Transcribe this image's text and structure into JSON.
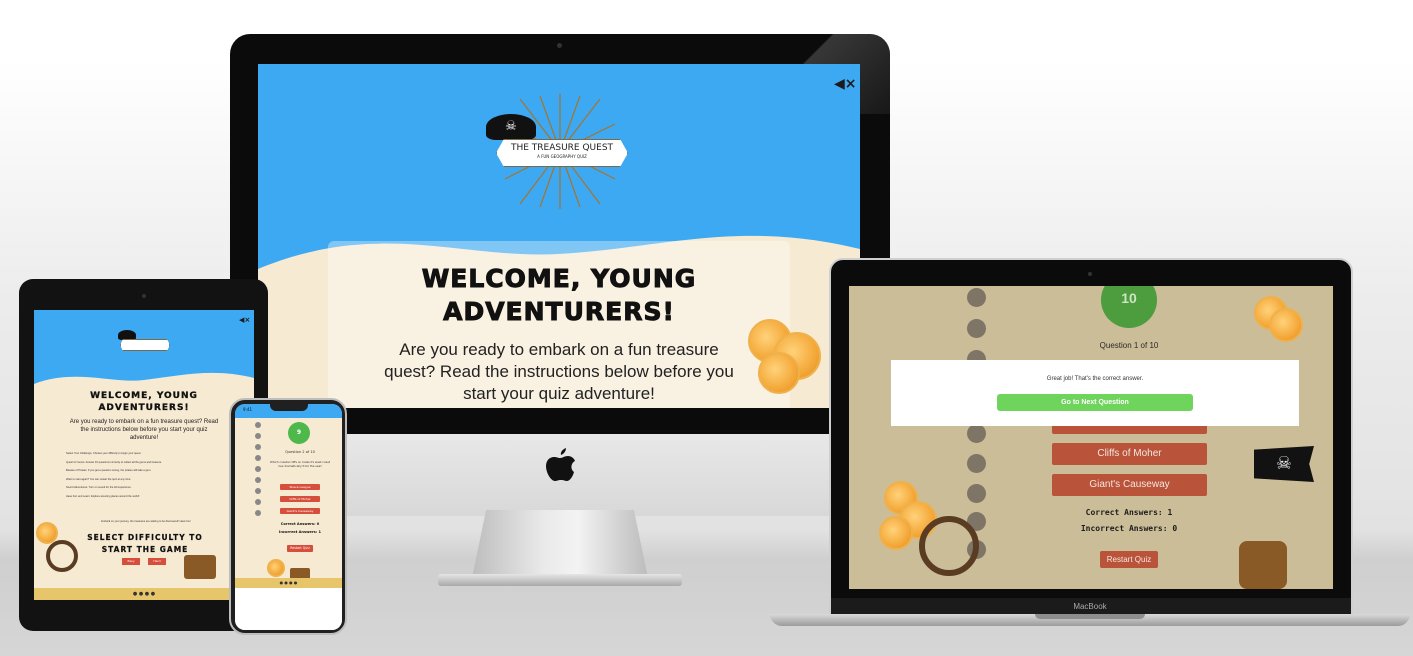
{
  "imac": {
    "logo_title": "THE TREASURE QUEST",
    "logo_subtitle": "A FUN GEOGRAPHY QUIZ",
    "mute_icon": "speaker-mute-icon",
    "heading": "WELCOME, YOUNG ADVENTURERS!",
    "intro": "Are you ready to embark on a fun treasure quest? Read the instructions below before you start your quiz adventure!"
  },
  "laptop": {
    "timer": "10",
    "question_counter": "Question 1 of 10",
    "feedback_text": "Great job! That's the correct answer.",
    "next_button": "Go to Next Question",
    "answers": [
      "Cliffs of Moher",
      "Giant's Causeway"
    ],
    "correct_label": "Correct Answers: 1",
    "incorrect_label": "Incorrect Answers: 0",
    "restart_button": "Restart Quiz",
    "brand": "MacBook"
  },
  "ipad": {
    "heading": "WELCOME, YOUNG ADVENTURERS!",
    "intro": "Are you ready to embark on a fun treasure quest? Read the instructions below before you start your quiz adventure!",
    "instructions": [
      "Select Your Challenge: Choose your difficulty to begin your quest.",
      "Quest for Gems: Answer 10 questions correctly to collect all the gems and treasure.",
      "Beware of Pirates: If you get a question wrong, the pirates will take a gem.",
      "Want to start again? You can restart the quiz at any time.",
      "Sound Adventures: Turn on sound for the full experience.",
      "Have Fun and Learn: Explore amazing places around the world!"
    ],
    "note": "Embark on your journey, the treasures are waiting to be discovered! Have fun!",
    "difficulty_heading": "SELECT DIFFICULTY TO START THE GAME",
    "buttons": [
      "Easy",
      "Hard"
    ]
  },
  "iphone": {
    "time": "9:41",
    "timer": "9",
    "question_counter": "Question 2 of 10",
    "question": "Which coastal cliffs on Ireland's west coast rise dramatically from the sea?",
    "answers": [
      "Slieve League",
      "Cliffs of Moher",
      "Giant's Causeway"
    ],
    "correct_label": "Correct Answers: 0",
    "incorrect_label": "Incorrect Answers: 1",
    "restart_button": "Restart Quiz"
  },
  "colors": {
    "sky": "#3ca9f2",
    "sand": "#f6ead3",
    "answer_red": "#b9533a",
    "next_green": "#6fd45c",
    "timer_green": "#4fb84a"
  }
}
